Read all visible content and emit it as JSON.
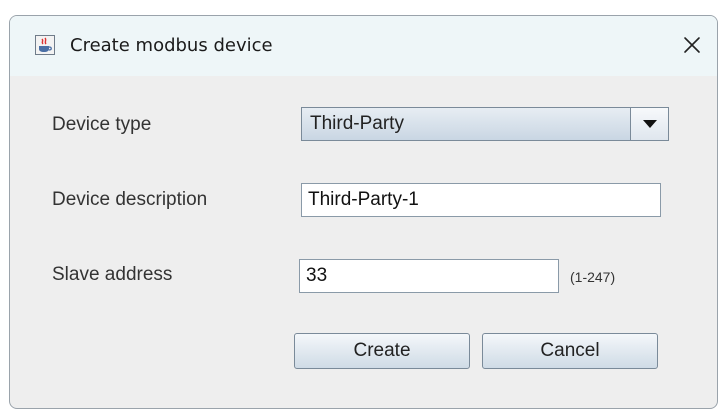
{
  "window": {
    "title": "Create modbus device",
    "icon": "java-cup-icon",
    "close_glyph": "✕"
  },
  "form": {
    "device_type": {
      "label": "Device type",
      "selected": "Third-Party"
    },
    "device_description": {
      "label": "Device description",
      "value": "Third-Party-1"
    },
    "slave_address": {
      "label": "Slave address",
      "value": "33",
      "range_hint": "(1-247)"
    }
  },
  "buttons": {
    "create": "Create",
    "cancel": "Cancel"
  }
}
